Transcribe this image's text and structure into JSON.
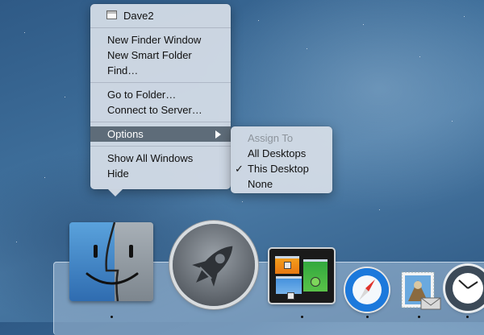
{
  "finder_menu": {
    "window_item": "Dave2",
    "group1": [
      "New Finder Window",
      "New Smart Folder",
      "Find…"
    ],
    "group2": [
      "Go to Folder…",
      "Connect to Server…"
    ],
    "options_label": "Options",
    "group4": [
      "Show All Windows",
      "Hide"
    ]
  },
  "options_submenu": {
    "header": "Assign To",
    "items": [
      "All Desktops",
      "This Desktop",
      "None"
    ],
    "checked_item": "This Desktop",
    "check_glyph": "✓"
  },
  "dock": {
    "apps": [
      {
        "icon": "finder-icon",
        "running": true
      },
      {
        "icon": "launchpad-icon",
        "running": false
      },
      {
        "icon": "mission-control-icon",
        "running": true
      },
      {
        "icon": "safari-icon",
        "running": true
      },
      {
        "icon": "mail-icon",
        "running": true
      },
      {
        "icon": "clock-icon",
        "running": true
      }
    ]
  },
  "colors": {
    "menu_highlight": "#5e6c79",
    "menu_background": "#d6dee7",
    "desktop": "#3d6d99"
  }
}
